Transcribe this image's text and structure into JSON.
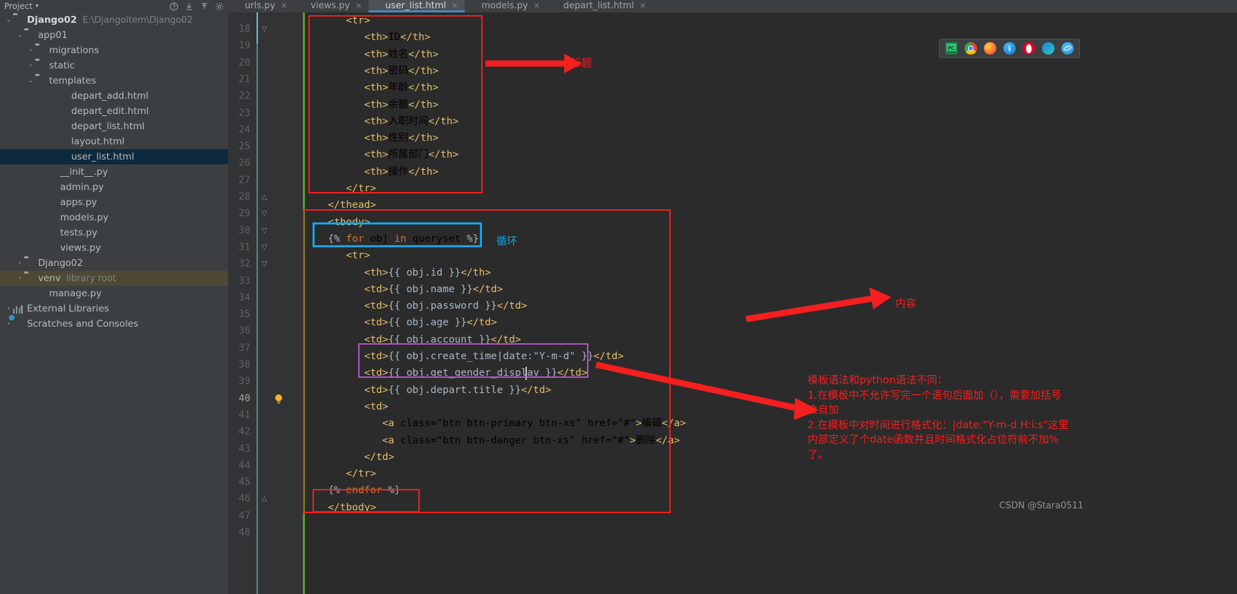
{
  "toolbar": {
    "title": "Project",
    "caret": "▾",
    "icons": [
      "help-icon",
      "collapse-all-icon",
      "expand-all-icon",
      "settings-icon"
    ]
  },
  "sidebar": {
    "items": [
      {
        "arrow": "⌄",
        "icon": "folder-icon",
        "label": "Django02",
        "sub": "E:\\Djangoitem\\Django02",
        "indent": 6,
        "bold": true
      },
      {
        "arrow": "⌄",
        "icon": "folder-module-icon",
        "label": "app01",
        "sub": "",
        "indent": 22,
        "bold": false
      },
      {
        "arrow": "›",
        "icon": "folder-module-icon",
        "label": "migrations",
        "sub": "",
        "indent": 38,
        "bold": false
      },
      {
        "arrow": "›",
        "icon": "folder-icon",
        "label": "static",
        "sub": "",
        "indent": 38,
        "bold": false
      },
      {
        "arrow": "⌄",
        "icon": "folder-icon",
        "label": "templates",
        "sub": "",
        "indent": 38,
        "bold": false
      },
      {
        "arrow": "",
        "icon": "html-file-icon",
        "label": "depart_add.html",
        "sub": "",
        "indent": 70,
        "bold": false
      },
      {
        "arrow": "",
        "icon": "html-file-icon",
        "label": "depart_edit.html",
        "sub": "",
        "indent": 70,
        "bold": false
      },
      {
        "arrow": "",
        "icon": "html-file-icon",
        "label": "depart_list.html",
        "sub": "",
        "indent": 70,
        "bold": false
      },
      {
        "arrow": "",
        "icon": "html-file-icon",
        "label": "layout.html",
        "sub": "",
        "indent": 70,
        "bold": false
      },
      {
        "arrow": "",
        "icon": "html-file-icon",
        "label": "user_list.html",
        "sub": "",
        "indent": 70,
        "bold": false,
        "selected": true
      },
      {
        "arrow": "",
        "icon": "python-file-icon",
        "label": "__init__.py",
        "sub": "",
        "indent": 54,
        "bold": false
      },
      {
        "arrow": "",
        "icon": "python-file-icon",
        "label": "admin.py",
        "sub": "",
        "indent": 54,
        "bold": false
      },
      {
        "arrow": "",
        "icon": "python-file-icon",
        "label": "apps.py",
        "sub": "",
        "indent": 54,
        "bold": false
      },
      {
        "arrow": "",
        "icon": "python-file-icon",
        "label": "models.py",
        "sub": "",
        "indent": 54,
        "bold": false
      },
      {
        "arrow": "",
        "icon": "python-file-icon",
        "label": "tests.py",
        "sub": "",
        "indent": 54,
        "bold": false
      },
      {
        "arrow": "",
        "icon": "python-file-icon",
        "label": "views.py",
        "sub": "",
        "indent": 54,
        "bold": false
      },
      {
        "arrow": "›",
        "icon": "folder-module-icon",
        "label": "Django02",
        "sub": "",
        "indent": 22,
        "bold": false
      },
      {
        "arrow": "›",
        "icon": "folder-icon",
        "label": "venv",
        "sub": "library root",
        "indent": 22,
        "bold": false,
        "venv": true
      },
      {
        "arrow": "",
        "icon": "python-file-icon",
        "label": "manage.py",
        "sub": "",
        "indent": 38,
        "bold": false
      },
      {
        "arrow": "›",
        "icon": "external-libraries-icon",
        "label": "External Libraries",
        "sub": "",
        "indent": 6,
        "bold": false
      },
      {
        "arrow": "›",
        "icon": "scratches-icon",
        "label": "Scratches and Consoles",
        "sub": "",
        "indent": 6,
        "bold": false
      }
    ]
  },
  "tabs": [
    {
      "label": "urls.py",
      "icon": "python-file-icon",
      "active": false
    },
    {
      "label": "views.py",
      "icon": "python-file-icon",
      "active": false
    },
    {
      "label": "user_list.html",
      "icon": "html-file-icon",
      "active": true
    },
    {
      "label": "models.py",
      "icon": "python-file-icon",
      "active": false
    },
    {
      "label": "depart_list.html",
      "icon": "html-file-icon",
      "active": false
    }
  ],
  "editor": {
    "first_line": 18,
    "line_numbers": [
      18,
      19,
      20,
      21,
      22,
      23,
      24,
      25,
      26,
      27,
      28,
      29,
      30,
      31,
      32,
      33,
      34,
      35,
      36,
      37,
      38,
      39,
      40,
      41,
      42,
      43,
      44,
      45,
      46,
      47,
      48
    ],
    "current_line": 40,
    "lines": [
      "      <tr>",
      "         <th>ID</th>",
      "         <th>姓名</th>",
      "         <th>密码</th>",
      "         <th>年龄</th>",
      "         <th>余额</th>",
      "         <th>入职时间</th>",
      "         <th>性别</th>",
      "         <th>所属部门</th>",
      "         <th>操作</th>",
      "      </tr>",
      "   </thead>",
      "   <tbody>",
      "   {% for obj in queryset %}",
      "      <tr>",
      "         <th>{{ obj.id }}</th>",
      "         <td>{{ obj.name }}</td>",
      "         <td>{{ obj.password }}</td>",
      "         <td>{{ obj.age }}</td>",
      "         <td>{{ obj.account }}</td>",
      "         <td>{{ obj.create_time|date:\"Y-m-d\" }}</td>",
      "         <td>{{ obj.get_gender_display }}</td>",
      "         <td>{{ obj.depart.title }}</td>",
      "         <td>",
      "            <a class=\"btn btn-primary btn-xs\" href=\"#\">编辑</a>",
      "            <a class=\"btn btn-danger btn-xs\" href=\"#\">删除</a>",
      "         </td>",
      "      </tr>",
      "   {% endfor %}",
      "   </tbody>"
    ]
  },
  "annotations": {
    "title_label": "标题",
    "loop_label": "循环",
    "content_label": "内容",
    "notes": [
      "模板语法和python语法不同：",
      "1.在模板中不允许写完一个语句后面加（），需要加括号",
      "会自加",
      "2.在模板中对时间进行格式化：|date:\"Y-m-d H:i:s\"这里",
      "内部定义了个date函数并且时间格式化占位符前不加%",
      "了。"
    ]
  },
  "browser_bar": {
    "icons": [
      "pycharm-icon",
      "chrome-icon",
      "firefox-icon",
      "safari-icon",
      "opera-icon",
      "edge-icon",
      "ie-icon"
    ]
  },
  "watermark": "CSDN @Stara0511",
  "colors": {
    "accent_red": "#f41f1f",
    "accent_blue": "#19a3e6",
    "accent_purple": "#b455c9",
    "editor_bg": "#2b2b2b",
    "sidebar_bg": "#3c3f41",
    "selection_bg": "#0d293e"
  }
}
